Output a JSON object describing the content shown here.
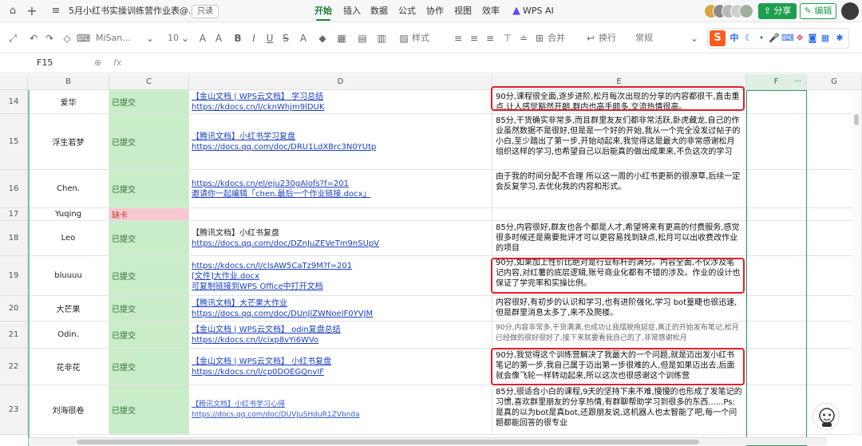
{
  "window": {
    "title": "5月小红书实操训练营作业表@...",
    "readonly_badge": "只读"
  },
  "menu": {
    "items": [
      "开始",
      "插入",
      "数据",
      "公式",
      "协作",
      "视图",
      "效率",
      "WPS AI"
    ],
    "active": "开始"
  },
  "actions": {
    "share_label": "分享",
    "edit_label": "编辑"
  },
  "toolbar": {
    "font_name": "MiSan...",
    "font_size": "10",
    "style_label": "样式",
    "merge_label": "合并",
    "wrap_label": "换行",
    "format_label": "常规",
    "ime_lang": "中"
  },
  "formula_bar": {
    "cell_ref": "F15",
    "fx": "fx"
  },
  "columns": [
    "B",
    "C",
    "D",
    "E",
    "F",
    "G"
  ],
  "col_f_extra": "···",
  "rows": [
    {
      "num": "14",
      "name": "爱华",
      "status": "已提交",
      "missing": false,
      "links": [
        {
          "t": "【金山文档 | WPS云文档】 学习总结",
          "k": "link"
        },
        {
          "t": "https://kdocs.cn/l/cknWhjm9lDUK",
          "k": "link"
        }
      ],
      "comment": "90分,课程很全面,逐步进阶,松月每次出现的分享的内容都很干,直击重点,让人感觉豁然开朗,群内也高手颇多,交流热情很高。",
      "grey": false
    },
    {
      "num": "15",
      "name": "浮生若梦",
      "status": "已提交",
      "missing": false,
      "links": [
        {
          "t": "【腾讯文档】小红书学习复盘",
          "k": "link"
        },
        {
          "t": "https://docs.qq.com/doc/DRU1LdXBrc3N0YUtp",
          "k": "link"
        }
      ],
      "comment": "85分,干货确实非常多,而且群里友友们都非常活跃,卧虎藏龙,自己的作业虽然数据不是很好,但是是一个好的开始,我从一个完全没发过帖子的小白,至少踏出了第一步,开始动起来,我觉得这是最大的非常感谢松月组织这样的学习,也希望自己以后能真的做出成果来,不负这次的学习",
      "grey": false
    },
    {
      "num": "16",
      "name": "Chen.",
      "status": "已提交",
      "missing": false,
      "links": [
        {
          "t": "https://kdocs.cn/el/eju230gAlofs?f=201",
          "k": "link"
        },
        {
          "t": "邀请你一起编辑「chen.最后一个作业链接.docx」",
          "k": "link"
        }
      ],
      "comment": "由于我的时间分配不合理 所以这一周的小红书更新的很潦草,后续一定会反复学习,去优化我的内容和形式。",
      "grey": false
    },
    {
      "num": "17",
      "name": "Yuqing",
      "status": "缺卡",
      "missing": true,
      "links": [],
      "comment": "",
      "grey": false
    },
    {
      "num": "18",
      "name": "Leo",
      "status": "已提交",
      "missing": false,
      "links": [
        {
          "t": "【腾讯文档】小红书复盘",
          "k": "plain"
        },
        {
          "t": "https://docs.qq.com/doc/DZnJuZEVeTm9nSUpV",
          "k": "link"
        }
      ],
      "comment": "85分,内容很好,群友也各个都是人才,希望将来有更高的付费服务,感觉很多时候还是需要批评才可以更容易找到缺点,松月可以出收费改作业的项目",
      "grey": false
    },
    {
      "num": "19",
      "name": "bluuuu",
      "status": "已提交",
      "missing": false,
      "links": [
        {
          "t": "https://kdocs.cn/l/clsAW5CaTz9M?f=201",
          "k": "link"
        },
        {
          "t": "[文件]大作业.docx",
          "k": "link"
        },
        {
          "t": "可复制链接到WPS Office中打开文档",
          "k": "link"
        }
      ],
      "comment": "90分,如果加上性价比绝对是行业标杆的满分。内容全面,不仅涉及笔记内容,对红薯的底层逻辑,账号商业化都有不错的涉及。作业的设计也保证了学完率和实操比例。",
      "grey": false
    },
    {
      "num": "20",
      "name": "大芒果",
      "status": "已提交",
      "missing": false,
      "links": [
        {
          "t": "【腾讯文档】大芒果大作业",
          "k": "link"
        },
        {
          "t": "https://docs.qq.com/doc/DUnJlZWNoelF0YVJM",
          "k": "link"
        }
      ],
      "comment": "内容很好,有初步的认识和学习,也有进阶强化,学习 bot篁睫也很迅速, 但是群里消息太多了,来不及爬楼。",
      "grey": false
    },
    {
      "num": "21",
      "name": "Odin.",
      "status": "已提交",
      "missing": false,
      "links": [
        {
          "t": "【金山文档 | WPS云文档】 odin复盘总结",
          "k": "link"
        },
        {
          "t": "https://kdocs.cn/l/cixp8vYi6WVo",
          "k": "link"
        }
      ],
      "comment": "90分,内容非常多,干货满满,也成功让我摆脱拖延症,真正的开始发布笔记,松月已经做的很好很好了,接下来就要看我自己的了,非常感谢松月",
      "grey": true
    },
    {
      "num": "22",
      "name": "花非花",
      "status": "已提交",
      "missing": false,
      "links": [
        {
          "t": "【金山文档 | WPS云文档】 小红书复盘",
          "k": "link"
        },
        {
          "t": "https://kdocs.cn/l/cp0DOEGQnvIF",
          "k": "link"
        }
      ],
      "comment": "90分,我觉得这个训练营解决了我最大的一个问题,就是迈出发小红书笔记的第一步,我自己属于迈出第一步很难的人,但是如果迈出去,后面就会像飞轮一样转动起来,所以这次也很感谢这个训练营",
      "grey": false
    },
    {
      "num": "23",
      "name": "刘海很卷",
      "status": "已提交",
      "missing": false,
      "links": [
        {
          "t": "【腾讯文档】小红书学习心得",
          "k": "small"
        },
        {
          "t": "https://docs.qq.com/doc/DUVJuSHduR1ZVbnda",
          "k": "small"
        }
      ],
      "comment": "85分,很适合小白的课程,9天的坚持下来不难,慢慢的也形成了发笔记的习惯,喜欢群里朋友的分享热情,有群聊帮助学习到很多的东西......Ps: 是真的以为bot是真bot,还跟朋友说,这机器人也太智能了吧,每一个问题都能回答的很专业",
      "grey": false
    }
  ]
}
